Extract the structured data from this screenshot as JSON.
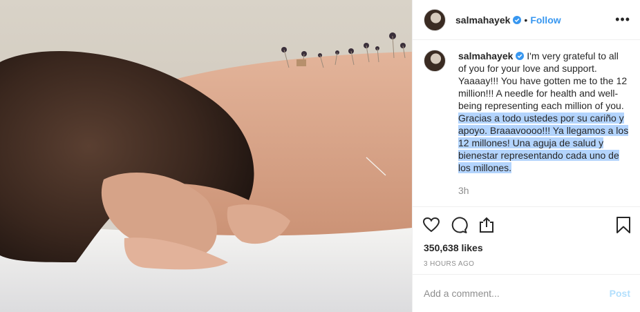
{
  "post": {
    "username": "salmahayek",
    "follow_label": "Follow",
    "dot": "•",
    "more_label": "•••",
    "caption_plain": "I'm very grateful to all of you for your love and support. Yaaaay!!! You have gotten me to the 12 million!!! A needle for health and well-being representing each million of you.",
    "caption_highlighted": "Gracias a todo ustedes por su cariño y apoyo. Braaavoooo!!! Ya llegamos a los 12 millones! Una aguja de salud y bienestar representando cada uno de los millones.",
    "time_ago": "3h",
    "likes": "350,638 likes",
    "posted": "3 HOURS AGO"
  },
  "comment": {
    "placeholder": "Add a comment...",
    "post_label": "Post"
  },
  "icons": {
    "like": "heart-icon",
    "comment": "comment-icon",
    "share": "share-icon",
    "save": "bookmark-icon",
    "verified": "verified-badge-icon"
  },
  "colors": {
    "link_blue": "#3897f0",
    "verified_blue": "#3897f0",
    "post_disabled": "#b2dffc",
    "highlight": "#b3d4fd",
    "muted": "#8e8e8e"
  }
}
